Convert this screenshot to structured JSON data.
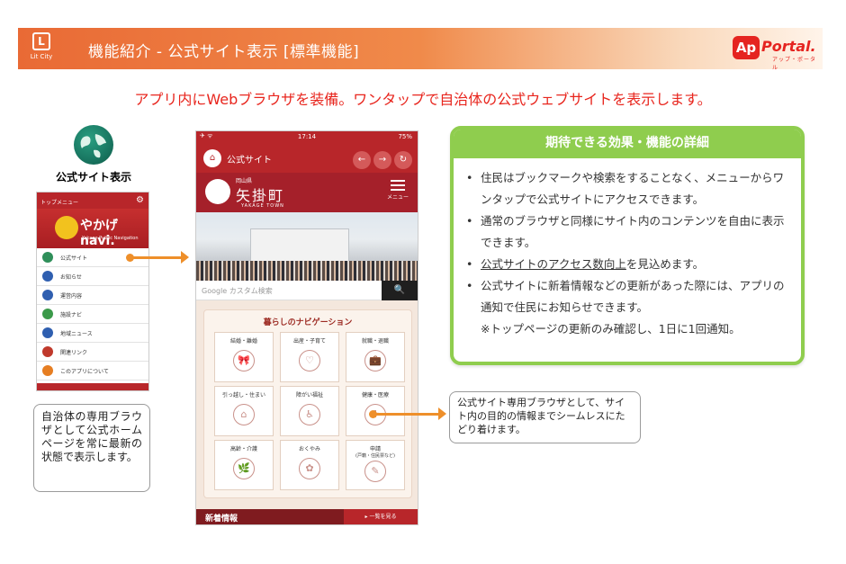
{
  "header": {
    "logo_box": "L",
    "logo_caption": "Lit City",
    "title": "機能紹介 - 公式サイト表示 [標準機能]",
    "brand_ap": "Ap",
    "brand_portal": "Portal.",
    "brand_sub": "アップ・ポータル"
  },
  "lead": "アプリ内にWebブラウザを装備。ワンタップで自治体の公式ウェブサイトを表示します。",
  "left": {
    "label": "公式サイト表示",
    "app": {
      "top_menu": "トップメニュー",
      "banner_name": "やかげnavi.",
      "banner_sub": "Yakage Public Navigation",
      "items": [
        {
          "label": "公式サイト",
          "color": "#2f8f5a"
        },
        {
          "label": "お知らせ",
          "color": "#2f5fb0"
        },
        {
          "label": "運営内容",
          "color": "#2f5fb0"
        },
        {
          "label": "施設ナビ",
          "color": "#3b9a4a"
        },
        {
          "label": "地域ニュース",
          "color": "#2f5fb0"
        },
        {
          "label": "関連リンク",
          "color": "#c0392b"
        },
        {
          "label": "このアプリについて",
          "color": "#e67e22"
        }
      ]
    },
    "note": "自治体の専用ブラウザとして公式ホームページを常に最新の状態で表示します。"
  },
  "phone": {
    "time": "17:14",
    "battery": "75%",
    "nav_title": "公式サイト",
    "town_pref": "岡山県",
    "town_name": "矢掛町",
    "town_roman": "YAKAGE TOWN",
    "menu_label": "メニュー",
    "search_placeholder": "Google カスタム検索",
    "nav_section_title": "暮らしのナビゲーション",
    "tiles": [
      {
        "label": "結婚・離婚",
        "sub": "",
        "icon": "🎀"
      },
      {
        "label": "出産・子育て",
        "sub": "",
        "icon": "♡"
      },
      {
        "label": "就職・退職",
        "sub": "",
        "icon": "💼"
      },
      {
        "label": "引っ越し・住まい",
        "sub": "",
        "icon": "⌂"
      },
      {
        "label": "障がい福祉",
        "sub": "",
        "icon": "♿"
      },
      {
        "label": "健康・医療",
        "sub": "",
        "icon": "✚"
      },
      {
        "label": "高齢・介護",
        "sub": "",
        "icon": "🌿"
      },
      {
        "label": "おくやみ",
        "sub": "",
        "icon": "✿"
      },
      {
        "label": "申請",
        "sub": "(戸籍・住民票など)",
        "icon": "✎"
      }
    ],
    "news_label": "新着情報",
    "news_more": "▸ 一覧を見る"
  },
  "features": {
    "heading": "期待できる効果・機能の詳細",
    "items": [
      "住民はブックマークや検索をすることなく、メニューからワンタップで公式サイトにアクセスできます。",
      "通常のブラウザと同様にサイト内のコンテンツを自由に表示できます。",
      "公式サイトのアクセス数向上",
      "公式サイトに新着情報などの更新があった際には、アプリの通知で住民にお知らせできます。"
    ],
    "item3_tail": "を見込めます。",
    "note": "※トップページの更新のみ確認し、1日に1回通知。"
  },
  "right_note": "公式サイト専用ブラウザとして、サイト内の目的の情報までシームレスにたどり着けます。",
  "colors": {
    "accent": "#e96a35",
    "brand_red": "#e52420",
    "green": "#8fcd4e",
    "arrow": "#ee8f2a",
    "app_red": "#b8262a"
  }
}
